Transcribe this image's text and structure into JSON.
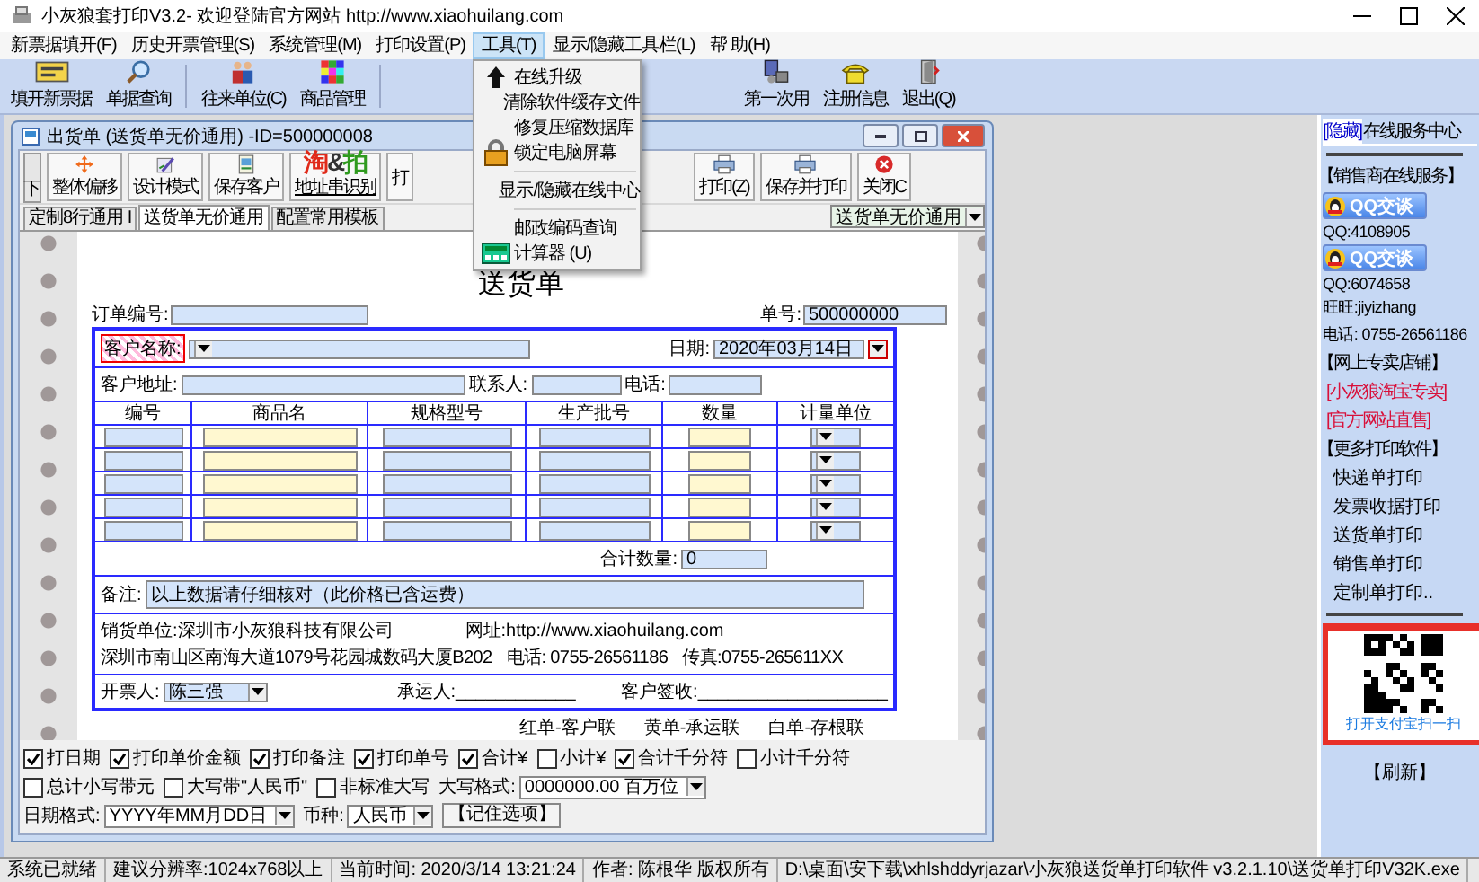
{
  "window": {
    "title": "小灰狼套打印V3.2- 欢迎登陆官方网站 http://www.xiaohuilang.com"
  },
  "menubar": [
    {
      "label": "新票据填开(F)",
      "selected": false
    },
    {
      "label": "历史开票管理(S)",
      "selected": false
    },
    {
      "label": "系统管理(M)",
      "selected": false
    },
    {
      "label": "打印设置(P)",
      "selected": false
    },
    {
      "label": "工具(T)",
      "selected": true
    },
    {
      "label": "显示/隐藏工具栏(L)",
      "selected": false
    },
    {
      "label": "帮 助(H)",
      "selected": false
    }
  ],
  "toolbar": [
    {
      "kind": "ticket",
      "label": "填开新票据"
    },
    {
      "kind": "search",
      "label": "单据查询"
    },
    {
      "kind": "people",
      "label": "往来单位(C)"
    },
    {
      "kind": "grid",
      "label": "商品管理"
    },
    {
      "kind": "gap"
    },
    {
      "kind": "computer",
      "label": "第一次用"
    },
    {
      "kind": "phone",
      "label": "注册信息"
    },
    {
      "kind": "exit",
      "label": "退出(Q)"
    }
  ],
  "tools_menu": [
    {
      "kind": "upgrade",
      "label": "在线升级"
    },
    {
      "kind": "plain",
      "label": "清除软件缓存文件"
    },
    {
      "kind": "plain",
      "label": "修复压缩数据库"
    },
    {
      "kind": "lock",
      "label": "锁定电脑屏幕"
    },
    {
      "kind": "separator"
    },
    {
      "kind": "plain",
      "label": "显示/隐藏在线中心"
    },
    {
      "kind": "separator"
    },
    {
      "kind": "plain",
      "label": "邮政编码查询"
    },
    {
      "kind": "calculator",
      "label": "计算器 (U)"
    }
  ],
  "child_window": {
    "title": "出货单 (送货单无价通用) -ID=500000008",
    "scroll_label": "下",
    "toolbar": [
      {
        "kind": "move",
        "label": "整体偏移"
      },
      {
        "kind": "design",
        "label": "设计模式"
      },
      {
        "kind": "save",
        "label": "保存客户"
      },
      {
        "kind": "logo",
        "label": "地址串识别",
        "logo": [
          {
            "text": "淘",
            "color": "#e02a1a"
          },
          {
            "text": "&",
            "color": "#333333"
          },
          {
            "text": "拍",
            "color": "#2f9a1e"
          }
        ]
      },
      {
        "kind": "text",
        "label": "打"
      },
      {
        "kind": "gap"
      },
      {
        "kind": "print",
        "label": "打印(Z)"
      },
      {
        "kind": "print",
        "label": "保存并打印"
      },
      {
        "kind": "close",
        "label": "关闭C"
      }
    ],
    "tabs": [
      {
        "label": "定制8行通用 I",
        "selected": false
      },
      {
        "label": "送货单无价通用",
        "selected": true
      },
      {
        "label": "配置常用模板",
        "selected": false
      }
    ],
    "template_select": "送货单无价通用",
    "form": {
      "title": "送货单",
      "order_no_label": "订单编号:",
      "doc_no_label": "单号:",
      "doc_no": "500000000",
      "customer_label": "客户名称:",
      "date_label": "日期:",
      "date": "2020年03月14日",
      "address_label": "客户地址:",
      "contact_label": "联系人:",
      "phone_label": "电话:",
      "columns": [
        {
          "label": "编号",
          "kind": "text"
        },
        {
          "label": "商品名",
          "kind": "highlight"
        },
        {
          "label": "规格型号",
          "kind": "text"
        },
        {
          "label": "生产批号",
          "kind": "text"
        },
        {
          "label": "数量",
          "kind": "highlight"
        },
        {
          "label": "计量单位",
          "kind": "select"
        }
      ],
      "total_label": "合计数量:",
      "total": "0",
      "remark_label": "备注:",
      "remark": "以上数据请仔细核对（此价格已含运费）",
      "company": "销货单位:深圳市小灰狼科技有限公司",
      "website": "网址:http://www.xiaohuilang.com",
      "address": "深圳市南山区南海大道1079号花园城数码大厦B202",
      "phone": "电话: 0755-26561186",
      "fax": "传真:0755-265611XX",
      "issuer_label": "开票人:",
      "issuer": "陈三强",
      "carrier": "承运人:____________",
      "receiver": "客户签收:___________________",
      "copies": [
        "红单-客户联",
        "黄单-承运联",
        "白单-存根联"
      ]
    },
    "options": {
      "checkboxes": [
        {
          "label": "打日期",
          "checked": true
        },
        {
          "label": "打印单价金额",
          "checked": true
        },
        {
          "label": "打印备注",
          "checked": true
        },
        {
          "label": "打印单号",
          "checked": true
        },
        {
          "label": "合计¥",
          "checked": true
        },
        {
          "label": "小计¥",
          "checked": false
        },
        {
          "label": "合计千分符",
          "checked": true
        },
        {
          "label": "小计千分符",
          "checked": false
        },
        {
          "label": "总计小写带元",
          "checked": false
        },
        {
          "label": "大写带\"人民币\"",
          "checked": false
        },
        {
          "label": "非标准大写",
          "checked": false
        }
      ],
      "selects": [
        {
          "label": "大写格式:",
          "value": "0000000.00 百万位"
        },
        {
          "label": "日期格式:",
          "value": "YYYY年MM月DD日"
        },
        {
          "label": "币种:",
          "value": "人民币"
        }
      ],
      "button": "【记住选项】"
    }
  },
  "sidebar": {
    "hide_link": "[隐藏]",
    "title": "在线服务中心",
    "items": [
      {
        "kind": "rule"
      },
      {
        "kind": "section",
        "text": "【销售商在线服务】"
      },
      {
        "kind": "qq",
        "text": "QQ交谈"
      },
      {
        "kind": "small",
        "text": "QQ:4108905"
      },
      {
        "kind": "qq",
        "text": "QQ交谈"
      },
      {
        "kind": "small",
        "text": "QQ:6074658"
      },
      {
        "kind": "text",
        "text": "旺旺:jiyizhang"
      },
      {
        "kind": "text",
        "text": "电话: 0755-26561186"
      },
      {
        "kind": "section",
        "text": "【网上专卖店铺】"
      },
      {
        "kind": "link",
        "text": "[小灰狼淘宝专卖]"
      },
      {
        "kind": "link",
        "text": "[官方网站直售]"
      },
      {
        "kind": "section",
        "text": "【更多打印软件】"
      },
      {
        "kind": "item",
        "text": "快递单打印"
      },
      {
        "kind": "item",
        "text": "发票收据打印"
      },
      {
        "kind": "item",
        "text": "送货单打印"
      },
      {
        "kind": "item",
        "text": "销售单打印"
      },
      {
        "kind": "item",
        "text": "定制单打印.."
      },
      {
        "kind": "rule"
      },
      {
        "kind": "qr",
        "text": "打开支付宝扫一扫"
      },
      {
        "kind": "refresh",
        "text": "【刷新】"
      }
    ]
  },
  "status_bar": [
    "系统已就绪",
    "建议分辨率:1024x768以上",
    "当前时间: 2020/3/14 13:21:24",
    "作者: 陈根华 版权所有",
    "D:\\桌面\\安下载\\xhlshddyrjazar\\小灰狼送货单打印软件 v3.2.1.10\\送货单打印V32K.exe"
  ]
}
